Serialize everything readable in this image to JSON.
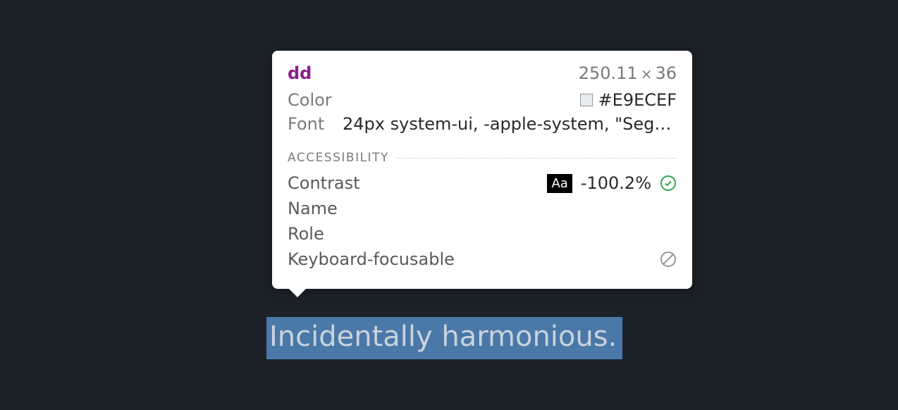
{
  "highlighted_text": "Incidentally harmonious.",
  "tooltip": {
    "tag_name": "dd",
    "dimensions": {
      "width": "250.11",
      "x": "×",
      "height": "36"
    },
    "properties": {
      "color_label": "Color",
      "color_value": "#E9ECEF",
      "font_label": "Font",
      "font_value": "24px system-ui, -apple-system, \"Segoe…"
    },
    "accessibility": {
      "section_title": "ACCESSIBILITY",
      "contrast_label": "Contrast",
      "contrast_badge": "Aa",
      "contrast_value": "-100.2%",
      "name_label": "Name",
      "role_label": "Role",
      "focusable_label": "Keyboard-focusable"
    }
  }
}
